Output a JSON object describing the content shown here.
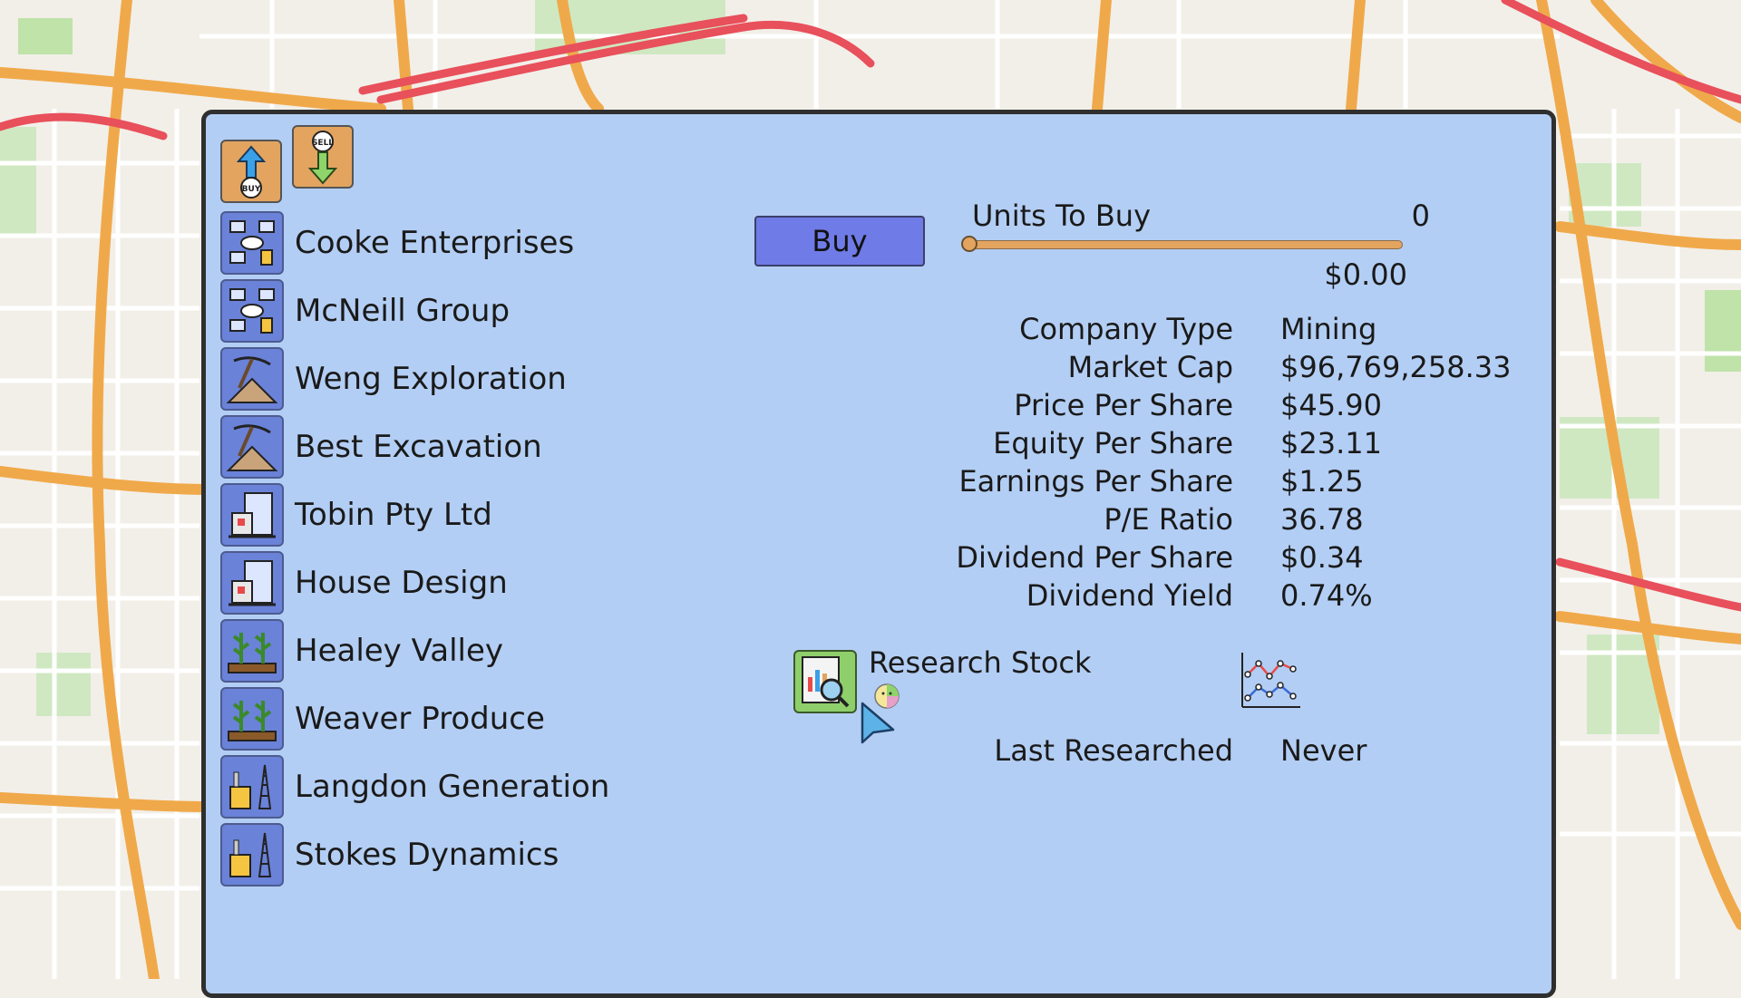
{
  "mode_buttons": {
    "buy_icon_text": "BUY",
    "sell_icon_text": "SELL"
  },
  "companies": [
    {
      "name": "Cooke Enterprises",
      "icon": "tech-network-icon"
    },
    {
      "name": "McNeill Group",
      "icon": "tech-network-icon"
    },
    {
      "name": "Weng Exploration",
      "icon": "pickaxe-mining-icon"
    },
    {
      "name": "Best Excavation",
      "icon": "pickaxe-mining-icon"
    },
    {
      "name": "Tobin Pty Ltd",
      "icon": "building-construction-icon"
    },
    {
      "name": "House Design",
      "icon": "building-construction-icon"
    },
    {
      "name": "Healey Valley",
      "icon": "crops-agriculture-icon"
    },
    {
      "name": "Weaver Produce",
      "icon": "crops-agriculture-icon"
    },
    {
      "name": "Langdon Generation",
      "icon": "power-plant-icon"
    },
    {
      "name": "Stokes Dynamics",
      "icon": "power-plant-icon"
    }
  ],
  "trade": {
    "button_label": "Buy",
    "units_label": "Units To Buy",
    "units_value": "0",
    "units_fraction": 0,
    "cost": "$0.00"
  },
  "info": [
    {
      "label": "Company Type",
      "value": "Mining"
    },
    {
      "label": "Market Cap",
      "value": "$96,769,258.33"
    },
    {
      "label": "Price Per Share",
      "value": "$45.90"
    },
    {
      "label": "Equity Per Share",
      "value": "$23.11"
    },
    {
      "label": "Earnings Per Share",
      "value": "$1.25"
    },
    {
      "label": "P/E Ratio",
      "value": "36.78"
    },
    {
      "label": "Dividend Per Share",
      "value": "$0.34"
    },
    {
      "label": "Dividend Yield",
      "value": "0.74%"
    }
  ],
  "research": {
    "label": "Research Stock",
    "last_label": "Last Researched",
    "last_value": "Never"
  },
  "colors": {
    "panel_bg": "#b3cef4",
    "accent_orange": "#e3a460",
    "buy_button": "#6f7be6",
    "company_icon_bg": "#6a82d8"
  }
}
